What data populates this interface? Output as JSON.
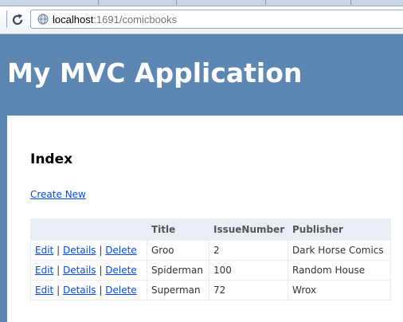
{
  "browser": {
    "url_host": "localhost",
    "url_path": ":1691/comicbooks"
  },
  "header": {
    "title": "My MVC Application"
  },
  "main": {
    "heading": "Index",
    "create_new": "Create New",
    "separator": "|",
    "columns": [
      "",
      "Title",
      "IssueNumber",
      "Publisher"
    ],
    "rows": [
      {
        "edit": "Edit",
        "details": "Details",
        "delete": "Delete",
        "title": "Groo",
        "issue_number": "2",
        "publisher": "Dark Horse Comics"
      },
      {
        "edit": "Edit",
        "details": "Details",
        "delete": "Delete",
        "title": "Spiderman",
        "issue_number": "100",
        "publisher": "Random House"
      },
      {
        "edit": "Edit",
        "details": "Details",
        "delete": "Delete",
        "title": "Superman",
        "issue_number": "72",
        "publisher": "Wrox"
      }
    ]
  },
  "icons": {
    "reload": "reload-icon",
    "globe": "globe-icon"
  },
  "colors": {
    "page_bg": "#5c87b2",
    "link": "#034af3",
    "table_header": "#e8eef4"
  }
}
